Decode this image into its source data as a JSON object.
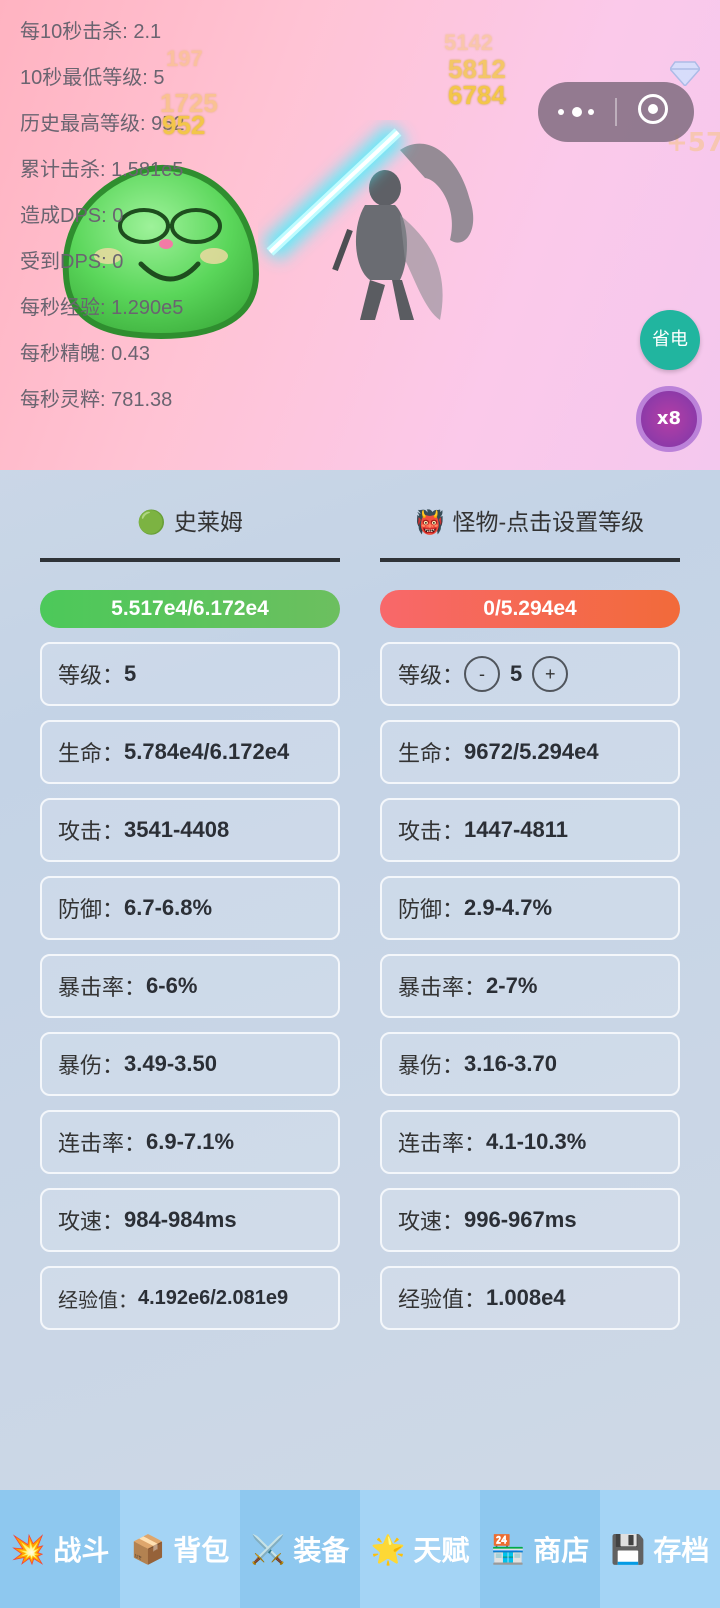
{
  "battle_stats": [
    "每10秒击杀: 2.1",
    "10秒最低等级: 5",
    "历史最高等级: 952",
    "累计击杀: 1.581e5",
    "造成DPS: 0",
    "受到DPS: 0",
    "每秒经验: 1.290e5",
    "每秒精魄: 0.43",
    "每秒灵粹: 781.38"
  ],
  "floating_numbers": {
    "n1": "6784",
    "n2": "5812",
    "n3": "5142",
    "n4": "952",
    "n5": "1725",
    "n6": "197",
    "bonus": "+57"
  },
  "capsule": {
    "more_icon": "more-dots-icon",
    "close_icon": "target-circle-icon"
  },
  "buttons": {
    "save_power": "省电",
    "speed": "x8"
  },
  "player": {
    "emoji": "🟢",
    "name": "史莱姆",
    "hp_bar": "5.517e4/6.172e4",
    "rows": [
      {
        "label": "等级：",
        "value": "5"
      },
      {
        "label": "生命：",
        "value": "5.784e4/6.172e4"
      },
      {
        "label": "攻击：",
        "value": "3541-4408"
      },
      {
        "label": "防御：",
        "value": "6.7-6.8%"
      },
      {
        "label": "暴击率：",
        "value": "6-6%"
      },
      {
        "label": "暴伤：",
        "value": "3.49-3.50"
      },
      {
        "label": "连击率：",
        "value": "6.9-7.1%"
      },
      {
        "label": "攻速：",
        "value": "984-984ms"
      },
      {
        "label": "经验值：",
        "value": "4.192e6/2.081e9"
      }
    ]
  },
  "monster": {
    "emoji": "👹",
    "name": "怪物-点击设置等级",
    "hp_bar": "0/5.294e4",
    "level_label": "等级：",
    "level_value": "5",
    "minus": "-",
    "plus": "+",
    "rows": [
      {
        "label": "生命：",
        "value": "9672/5.294e4"
      },
      {
        "label": "攻击：",
        "value": "1447-4811"
      },
      {
        "label": "防御：",
        "value": "2.9-4.7%"
      },
      {
        "label": "暴击率：",
        "value": "2-7%"
      },
      {
        "label": "暴伤：",
        "value": "3.16-3.70"
      },
      {
        "label": "连击率：",
        "value": "4.1-10.3%"
      },
      {
        "label": "攻速：",
        "value": "996-967ms"
      },
      {
        "label": "经验值：",
        "value": "1.008e4"
      }
    ]
  },
  "nav": [
    {
      "icon": "💥",
      "label": "战斗"
    },
    {
      "icon": "📦",
      "label": "背包"
    },
    {
      "icon": "⚔️",
      "label": "装备"
    },
    {
      "icon": "🌟",
      "label": "天赋"
    },
    {
      "icon": "🏪",
      "label": "商店"
    },
    {
      "icon": "💾",
      "label": "存档"
    }
  ]
}
